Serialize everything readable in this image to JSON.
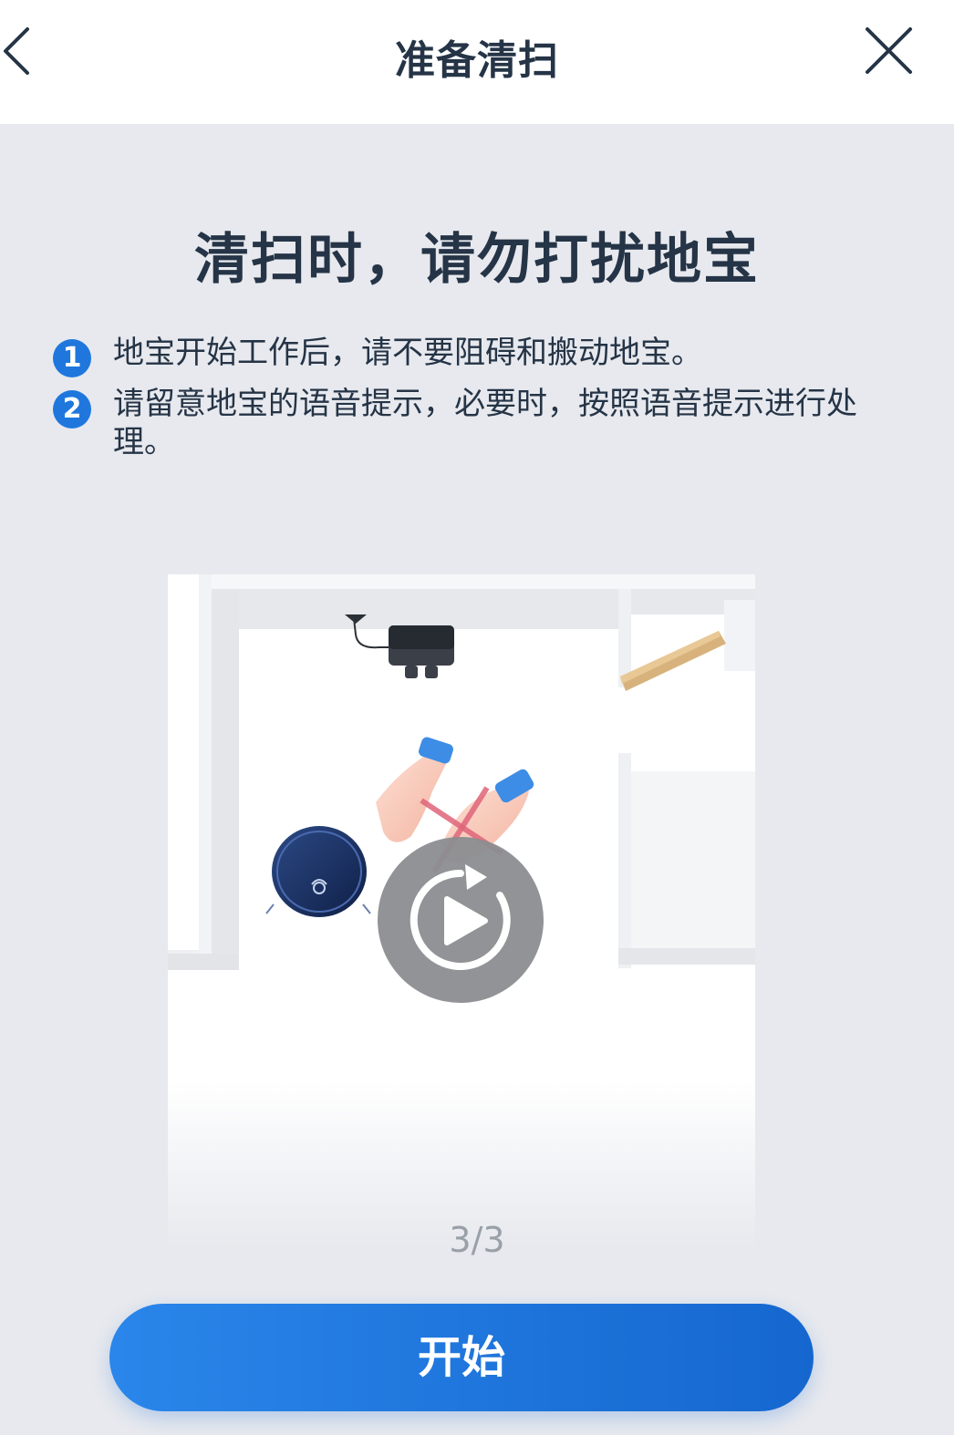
{
  "header": {
    "title": "准备清扫",
    "back_icon": "chevron-left-icon",
    "close_icon": "close-icon"
  },
  "headline": "清扫时，请勿打扰地宝",
  "tips": [
    {
      "number": "1",
      "text": "地宝开始工作后，请不要阻碍和搬动地宝。"
    },
    {
      "number": "2",
      "text": "请留意地宝的语音提示，必要时，按照语音提示进行处理。"
    }
  ],
  "illustration": {
    "play_icon": "replay-icon"
  },
  "page_indicator": "3/3",
  "start_button": {
    "label": "开始",
    "color": "#1f77dd"
  },
  "colors": {
    "accent": "#1f77dd",
    "text": "#253446",
    "background": "#e7e9ee"
  }
}
